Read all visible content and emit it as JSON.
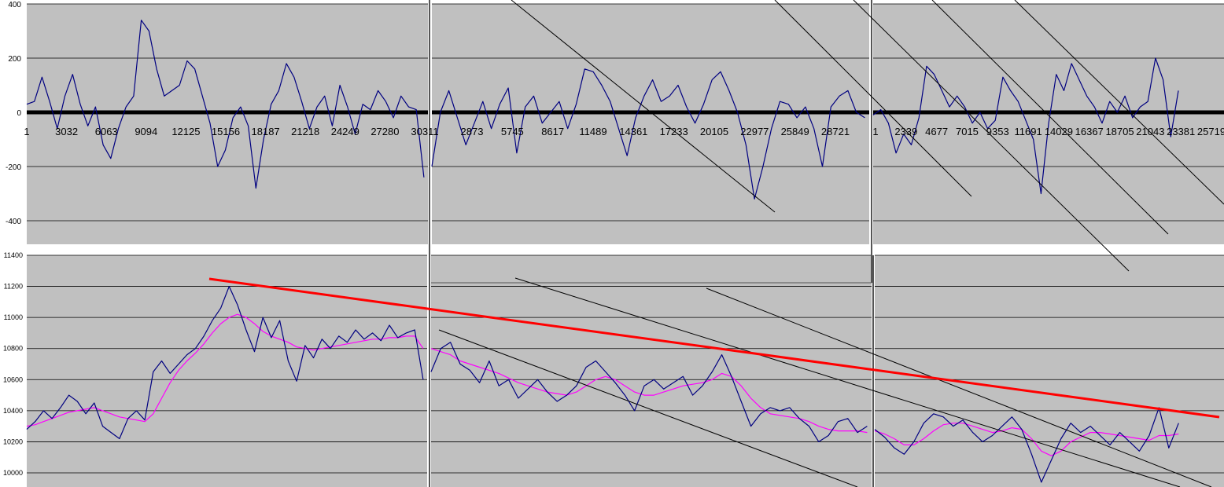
{
  "colors": {
    "plot_background": "#c0c0c0",
    "series_line": "#000080",
    "moving_average": "#ff00ff",
    "zero_line": "#000000",
    "trend_red": "#ff0000",
    "trend_black": "#000000",
    "gridline": "#000000"
  },
  "chart_data": [
    {
      "type": "line",
      "panel": "top-left",
      "ylim": [
        -500,
        400
      ],
      "yticks": [
        -400,
        -200,
        0,
        200,
        400
      ],
      "x_tick_labels": [
        "1",
        "3032",
        "6063",
        "9094",
        "12125",
        "15156",
        "18187",
        "21218",
        "24249",
        "27280",
        "30311"
      ],
      "grid": true,
      "series": [
        {
          "values": [
            30,
            40,
            130,
            40,
            -60,
            60,
            140,
            30,
            -50,
            20,
            -120,
            -170,
            -60,
            20,
            60,
            340,
            300,
            160,
            60,
            80,
            100,
            190,
            160,
            60,
            -40,
            -200,
            -140,
            -20,
            20,
            -50,
            -280,
            -100,
            30,
            80,
            180,
            130,
            40,
            -60,
            20,
            60,
            -50,
            100,
            20,
            -80,
            30,
            10,
            80,
            40,
            -20,
            60,
            20,
            10,
            -240
          ]
        }
      ]
    },
    {
      "type": "line",
      "panel": "top-middle",
      "ylim": [
        -500,
        400
      ],
      "x_tick_labels": [
        "2873",
        "5745",
        "8617",
        "11489",
        "14361",
        "17233",
        "20105",
        "22977",
        "25849",
        "28721"
      ],
      "grid": true,
      "series": [
        {
          "values": [
            -200,
            0,
            80,
            -20,
            -120,
            -40,
            40,
            -60,
            30,
            90,
            -150,
            20,
            60,
            -40,
            0,
            40,
            -60,
            30,
            160,
            150,
            100,
            40,
            -60,
            -160,
            -20,
            60,
            120,
            40,
            60,
            100,
            20,
            -40,
            30,
            120,
            150,
            80,
            0,
            -120,
            -320,
            -200,
            -60,
            40,
            30,
            -20,
            20,
            -60,
            -200,
            20,
            60,
            80,
            0,
            -20
          ]
        }
      ]
    },
    {
      "type": "line",
      "panel": "top-right",
      "ylim": [
        -500,
        400
      ],
      "x_tick_labels": [
        "1",
        "2339",
        "4677",
        "7015",
        "9353",
        "11691",
        "14029",
        "16367",
        "18705",
        "21043",
        "23381",
        "25719"
      ],
      "grid": true,
      "series": [
        {
          "values": [
            -10,
            10,
            -40,
            -150,
            -80,
            -120,
            -20,
            170,
            140,
            80,
            20,
            60,
            20,
            -40,
            0,
            -60,
            -30,
            130,
            80,
            40,
            -30,
            -100,
            -300,
            -40,
            140,
            80,
            180,
            120,
            60,
            20,
            -40,
            40,
            0,
            60,
            -20,
            20,
            40,
            200,
            120,
            -90,
            80
          ]
        }
      ]
    },
    {
      "type": "line",
      "panel": "bottom-left",
      "ylim": [
        9900,
        11400
      ],
      "yticks": [
        10000,
        10200,
        10400,
        10600,
        10800,
        11000,
        11200,
        11400
      ],
      "grid": true,
      "series": [
        {
          "values": [
            10280,
            10330,
            10400,
            10350,
            10420,
            10500,
            10460,
            10380,
            10450,
            10300,
            10260,
            10220,
            10350,
            10400,
            10340,
            10650,
            10720,
            10640,
            10700,
            10760,
            10800,
            10880,
            10980,
            11060,
            11200,
            11080,
            10920,
            10780,
            11000,
            10870,
            10980,
            10720,
            10590,
            10820,
            10740,
            10860,
            10800,
            10880,
            10840,
            10920,
            10860,
            10900,
            10850,
            10950,
            10870,
            10900,
            10920,
            10600
          ]
        },
        {
          "values": [
            10300,
            10310,
            10330,
            10350,
            10370,
            10390,
            10400,
            10410,
            10420,
            10400,
            10380,
            10360,
            10350,
            10340,
            10330,
            10380,
            10480,
            10580,
            10660,
            10720,
            10770,
            10830,
            10900,
            10960,
            11000,
            11020,
            11000,
            10960,
            10910,
            10880,
            10860,
            10840,
            10810,
            10800,
            10790,
            10800,
            10810,
            10820,
            10830,
            10840,
            10850,
            10860,
            10860,
            10870,
            10870,
            10880,
            10880,
            10800
          ]
        }
      ]
    },
    {
      "type": "line",
      "panel": "bottom-middle",
      "ylim": [
        9900,
        11400
      ],
      "grid": true,
      "series": [
        {
          "values": [
            10650,
            10800,
            10840,
            10700,
            10660,
            10580,
            10720,
            10560,
            10600,
            10480,
            10540,
            10600,
            10520,
            10460,
            10500,
            10560,
            10680,
            10720,
            10650,
            10580,
            10500,
            10400,
            10560,
            10600,
            10540,
            10580,
            10620,
            10500,
            10560,
            10650,
            10760,
            10620,
            10460,
            10300,
            10380,
            10420,
            10400,
            10420,
            10350,
            10300,
            10200,
            10240,
            10330,
            10350,
            10260,
            10300
          ]
        },
        {
          "values": [
            10800,
            10780,
            10760,
            10720,
            10700,
            10680,
            10660,
            10640,
            10610,
            10580,
            10560,
            10540,
            10520,
            10510,
            10500,
            10520,
            10560,
            10600,
            10620,
            10600,
            10560,
            10520,
            10500,
            10500,
            10520,
            10540,
            10560,
            10570,
            10580,
            10600,
            10640,
            10620,
            10560,
            10480,
            10420,
            10380,
            10370,
            10360,
            10350,
            10330,
            10300,
            10280,
            10270,
            10270,
            10270,
            10260
          ]
        }
      ]
    },
    {
      "type": "line",
      "panel": "bottom-right",
      "ylim": [
        9900,
        11400
      ],
      "grid": true,
      "series": [
        {
          "values": [
            10280,
            10230,
            10160,
            10120,
            10200,
            10320,
            10380,
            10360,
            10300,
            10340,
            10260,
            10200,
            10240,
            10300,
            10360,
            10280,
            10120,
            9940,
            10080,
            10220,
            10320,
            10260,
            10300,
            10240,
            10180,
            10260,
            10200,
            10140,
            10240,
            10420,
            10160,
            10320
          ]
        },
        {
          "values": [
            10270,
            10250,
            10220,
            10180,
            10180,
            10220,
            10270,
            10310,
            10320,
            10320,
            10300,
            10280,
            10260,
            10270,
            10290,
            10280,
            10220,
            10140,
            10110,
            10140,
            10200,
            10230,
            10260,
            10260,
            10250,
            10240,
            10230,
            10220,
            10210,
            10240,
            10240,
            10250
          ]
        }
      ]
    }
  ]
}
